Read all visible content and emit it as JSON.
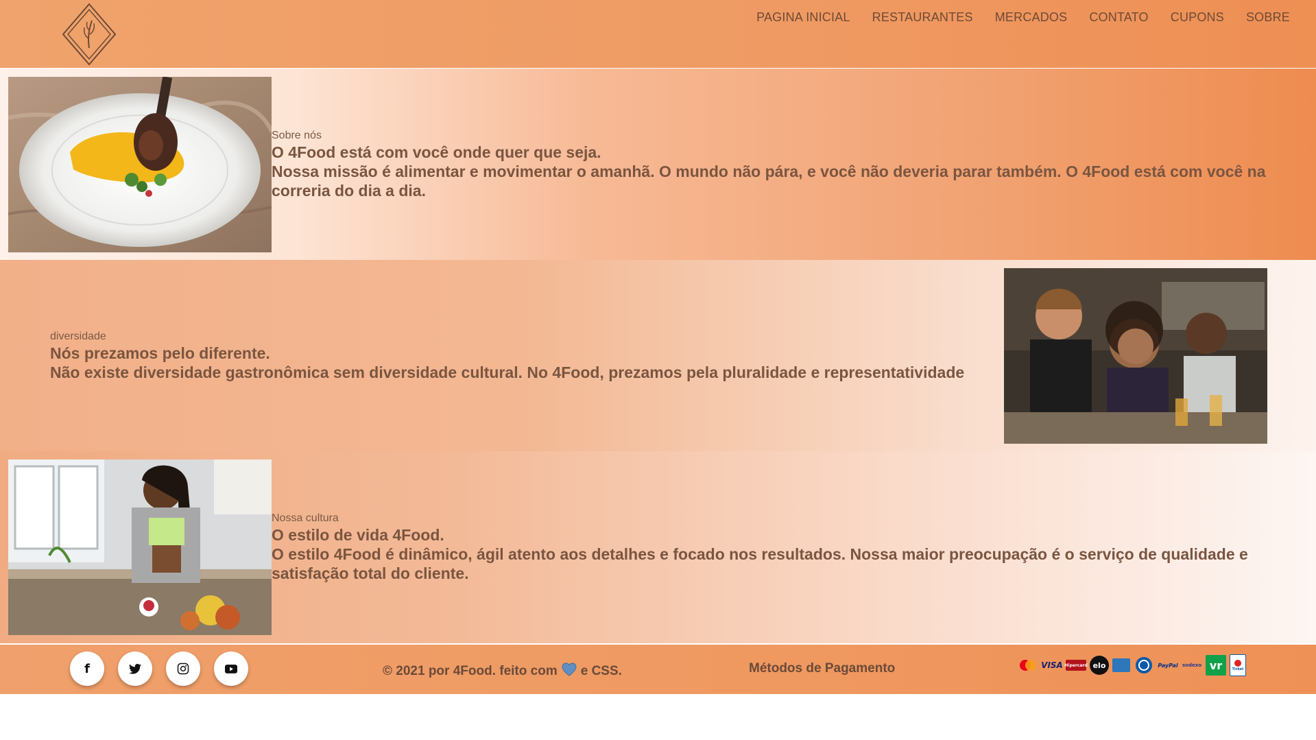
{
  "nav": {
    "items": [
      "PAGINA INICIAL",
      "RESTAURANTES",
      "MERCADOS",
      "CONTATO",
      "CUPONS",
      "SOBRE"
    ]
  },
  "sections": [
    {
      "eyebrow": "Sobre nós",
      "headline": "O 4Food está com você onde quer que seja.",
      "body": "Nossa missão é alimentar e movimentar o amanhã. O mundo não pára, e você não deveria parar também. O 4Food está com você na correria do dia a dia."
    },
    {
      "eyebrow": "diversidade",
      "headline": "Nós prezamos pelo diferente.",
      "body": "Não existe diversidade gastronômica sem diversidade cultural. No 4Food, prezamos pela pluralidade e representatividade"
    },
    {
      "eyebrow": "Nossa cultura",
      "headline": "O estilo de vida 4Food.",
      "body": "O estilo 4Food é dinâmico, ágil atento aos detalhes e focado nos resultados. Nossa maior preocupação é o serviço de qualidade e satisfação total do cliente."
    }
  ],
  "footer": {
    "social": [
      {
        "name": "facebook-icon",
        "glyph": "f"
      },
      {
        "name": "twitter-icon",
        "glyph": "🐦"
      },
      {
        "name": "instagram-icon",
        "glyph": "◎"
      },
      {
        "name": "youtube-icon",
        "glyph": "▶"
      }
    ],
    "copyright_prefix": "© 2021 por 4Food. feito com",
    "copyright_suffix": "e CSS.",
    "payment_title": "Métodos de Pagamento",
    "payment_logos": [
      "mastercard",
      "visa",
      "hipercard",
      "elo",
      "amex",
      "diners",
      "paypal",
      "sodexo",
      "vr",
      "ticket"
    ],
    "payment_logo_text": {
      "visa": "VISA",
      "hipercard": "Hipercard",
      "elo": "elo",
      "paypal": "PayPal",
      "sodexo": "sodexo",
      "vr": "vr",
      "ticket": "Ticket"
    }
  },
  "colors": {
    "header": "#ef9a62",
    "footer": "#ef9a62",
    "text": "#7a5540"
  }
}
